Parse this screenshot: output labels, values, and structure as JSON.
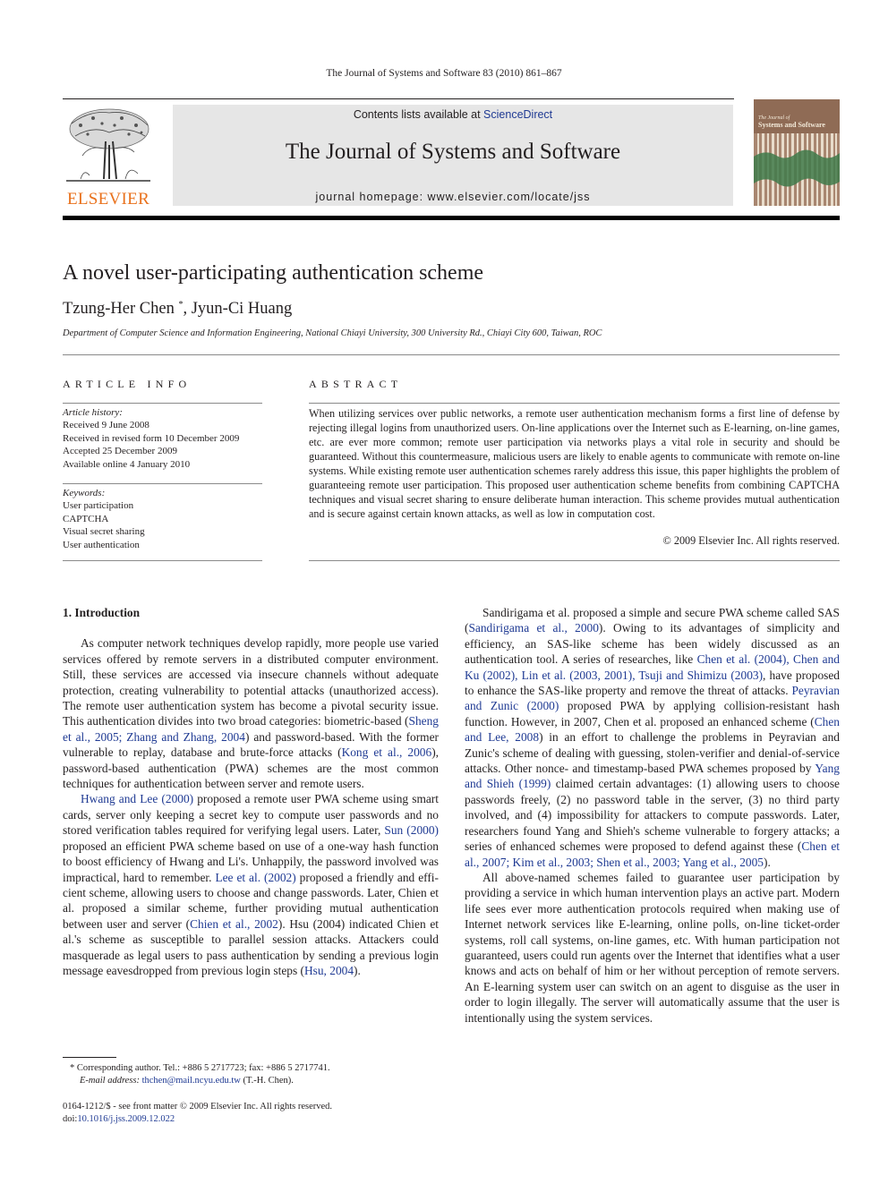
{
  "running_head": "The Journal of Systems and Software 83 (2010) 861–867",
  "masthead": {
    "publisher_logo_text": "ELSEVIER",
    "contents_prefix": "Contents lists available at ",
    "contents_link": "ScienceDirect",
    "journal_title": "The Journal of Systems and Software",
    "homepage": "journal homepage: www.elsevier.com/locate/jss",
    "cover_alt": "The Journal of Systems and Software cover"
  },
  "colors": {
    "link": "#1f3a93",
    "elsevier_orange": "#e9711c",
    "banner_gray": "#e6e6e6"
  },
  "article": {
    "title": "A novel user-participating authentication scheme",
    "authors": [
      {
        "name": "Tzung-Her Chen",
        "marker": "*"
      },
      {
        "name": "Jyun-Ci Huang",
        "marker": ""
      }
    ],
    "author_separator": ", ",
    "affiliation": "Department of Computer Science and Information Engineering, National Chiayi University, 300 University Rd., Chiayi City 600, Taiwan, ROC"
  },
  "article_info": {
    "heading": "ARTICLE INFO",
    "history_label": "Article history:",
    "history": [
      "Received 9 June 2008",
      "Received in revised form 10 December 2009",
      "Accepted 25 December 2009",
      "Available online 4 January 2010"
    ],
    "keywords_label": "Keywords:",
    "keywords": [
      "User participation",
      "CAPTCHA",
      "Visual secret sharing",
      "User authentication"
    ]
  },
  "abstract": {
    "heading": "ABSTRACT",
    "text": "When utilizing services over public networks, a remote user authentication mechanism forms a first line of defense by rejecting illegal logins from unauthorized users. On-line applications over the Internet such as E-learning, on-line games, etc. are ever more common; remote user participation via networks plays a vital role in security and should be guaranteed. Without this countermeasure, malicious users are likely to enable agents to communicate with remote on-line systems. While existing remote user authentica­tion schemes rarely address this issue, this paper highlights the problem of guaranteeing remote user participation. This proposed user authentication scheme benefits from combining CAPTCHA techniques and visual secret sharing to ensure deliberate human interaction. This scheme provides mutual authen­tication and is secure against certain known attacks, as well as low in computation cost.",
    "copyright": "© 2009 Elsevier Inc. All rights reserved."
  },
  "body": {
    "section_heading": "1. Introduction",
    "left": {
      "p1": [
        {
          "t": "As computer network techniques develop rapidly, more people use varied services offered by remote servers in a distributed com­puter environment. Still, these services are accessed via insecure channels without adequate protection, creating vulnerability to potential attacks (unauthorized access). The remote user authenti­cation system has become a pivotal security issue. This authentica­tion divides into two broad categories: biometric-based ("
        },
        {
          "link": "Sheng et al., 2005; Zhang and Zhang, 2004"
        },
        {
          "t": ") and password-based. With the former vulnerable to replay, database and brute-force attacks ("
        },
        {
          "link": "Kong et al., 2006"
        },
        {
          "t": "), password-based authentication (PWA) schemes are the most common techniques for authentication between ser­ver and remote users."
        }
      ],
      "p2": [
        {
          "link": "Hwang and Lee (2000)"
        },
        {
          "t": " proposed a remote user PWA scheme using smart cards, server only keeping a secret key to compute user passwords and no stored verification tables required for verifying legal users. Later, "
        },
        {
          "link": "Sun (2000)"
        },
        {
          "t": " proposed an efficient PWA scheme based on use of a one-way hash function to boost efficiency of Hwang and Li's. Unhappily, the password involved was impractical, hard to remember. "
        },
        {
          "link": "Lee et al. (2002)"
        },
        {
          "t": " proposed a friendly and effi­cient scheme, allowing users to choose and change passwords. La­ter, Chien et al. proposed a similar scheme, further providing mutual authentication between user and server ("
        },
        {
          "link": "Chien et al., 2002"
        },
        {
          "t": "). Hsu (2004) indicated Chien et al.'s scheme as susceptible to parallel session attacks. Attackers could masquerade as legal users to pass authentication by sending a previous login message eavesdropped from previous login steps ("
        },
        {
          "link": "Hsu, 2004"
        },
        {
          "t": ")."
        }
      ]
    },
    "right": {
      "p1": [
        {
          "t": "Sandirigama et al. proposed a simple and secure PWA scheme called SAS ("
        },
        {
          "link": "Sandirigama et al., 2000"
        },
        {
          "t": "). Owing to its advantages of simplicity and efficiency, an SAS-like scheme has been widely dis­cussed as an authentication tool. A series of researches, like "
        },
        {
          "link": "Chen et al. (2004), Chen and Ku (2002), Lin et al. (2003, 2001), Tsuji and Shimizu (2003)"
        },
        {
          "t": ", have proposed to enhance the SAS-like prop­erty and remove the threat of attacks. "
        },
        {
          "link": "Peyravian and Zunic (2000)"
        },
        {
          "t": " proposed PWA by applying collision-resistant hash function. How­ever, in 2007, Chen et al. proposed an enhanced scheme ("
        },
        {
          "link": "Chen and Lee, 2008"
        },
        {
          "t": ") in an effort to challenge the problems in Peyravian and Zunic's scheme of dealing with guessing, stolen-verifier and denial-of-service attacks. Other nonce- and timestamp-based PWA schemes proposed by "
        },
        {
          "link": "Yang and Shieh (1999)"
        },
        {
          "t": " claimed certain advantages: (1) allowing users to choose passwords freely, (2) no password table in the server, (3) no third party involved, and (4) impossibility for attackers to compute passwords. Later, research­ers found Yang and Shieh's scheme vulnerable to forgery attacks; a series of enhanced schemes were proposed to defend against these ("
        },
        {
          "link": "Chen et al., 2007; Kim et al., 2003; Shen et al., 2003; Yang et al., 2005"
        },
        {
          "t": ")."
        }
      ],
      "p2": [
        {
          "t": "All above-named schemes failed to guarantee user participation by providing a service in which human intervention plays an active part. Modern life sees ever more authentication protocols required when making use of Internet network services like E-learning, on­line polls, on-line ticket-order systems, roll call systems, on-line games, etc. With human participation not guaranteed, users could run agents over the Internet that identifies what a user knows and acts on behalf of him or her without perception of remote servers. An E-learning system user can switch on an agent to disguise as the user in order to login illegally. The server will automatically as­sume that the user is intentionally using the system services."
        }
      ]
    }
  },
  "footnote": {
    "marker": "*",
    "corresponding": "Corresponding author. Tel.: +886 5 2717723; fax: +886 5 2717741.",
    "email_label": "E-mail address:",
    "email": "thchen@mail.ncyu.edu.tw",
    "email_suffix": " (T.-H. Chen)."
  },
  "front_matter": {
    "issn_line": "0164-1212/$ - see front matter © 2009 Elsevier Inc. All rights reserved.",
    "doi_prefix": "doi:",
    "doi": "10.1016/j.jss.2009.12.022"
  }
}
